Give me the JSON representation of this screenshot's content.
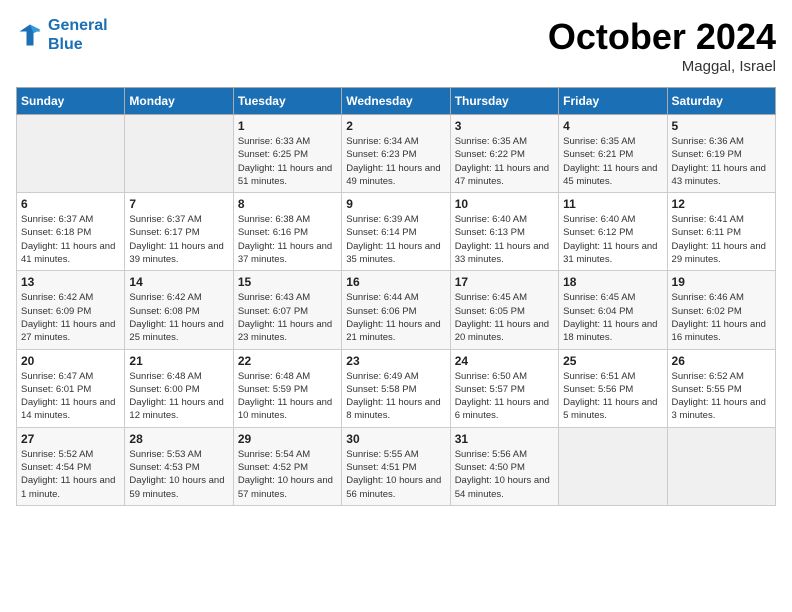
{
  "header": {
    "logo_line1": "General",
    "logo_line2": "Blue",
    "month": "October 2024",
    "location": "Maggal, Israel"
  },
  "weekdays": [
    "Sunday",
    "Monday",
    "Tuesday",
    "Wednesday",
    "Thursday",
    "Friday",
    "Saturday"
  ],
  "weeks": [
    [
      {
        "day": "",
        "sunrise": "",
        "sunset": "",
        "daylight": "",
        "empty": true
      },
      {
        "day": "",
        "sunrise": "",
        "sunset": "",
        "daylight": "",
        "empty": true
      },
      {
        "day": "1",
        "sunrise": "Sunrise: 6:33 AM",
        "sunset": "Sunset: 6:25 PM",
        "daylight": "Daylight: 11 hours and 51 minutes."
      },
      {
        "day": "2",
        "sunrise": "Sunrise: 6:34 AM",
        "sunset": "Sunset: 6:23 PM",
        "daylight": "Daylight: 11 hours and 49 minutes."
      },
      {
        "day": "3",
        "sunrise": "Sunrise: 6:35 AM",
        "sunset": "Sunset: 6:22 PM",
        "daylight": "Daylight: 11 hours and 47 minutes."
      },
      {
        "day": "4",
        "sunrise": "Sunrise: 6:35 AM",
        "sunset": "Sunset: 6:21 PM",
        "daylight": "Daylight: 11 hours and 45 minutes."
      },
      {
        "day": "5",
        "sunrise": "Sunrise: 6:36 AM",
        "sunset": "Sunset: 6:19 PM",
        "daylight": "Daylight: 11 hours and 43 minutes."
      }
    ],
    [
      {
        "day": "6",
        "sunrise": "Sunrise: 6:37 AM",
        "sunset": "Sunset: 6:18 PM",
        "daylight": "Daylight: 11 hours and 41 minutes."
      },
      {
        "day": "7",
        "sunrise": "Sunrise: 6:37 AM",
        "sunset": "Sunset: 6:17 PM",
        "daylight": "Daylight: 11 hours and 39 minutes."
      },
      {
        "day": "8",
        "sunrise": "Sunrise: 6:38 AM",
        "sunset": "Sunset: 6:16 PM",
        "daylight": "Daylight: 11 hours and 37 minutes."
      },
      {
        "day": "9",
        "sunrise": "Sunrise: 6:39 AM",
        "sunset": "Sunset: 6:14 PM",
        "daylight": "Daylight: 11 hours and 35 minutes."
      },
      {
        "day": "10",
        "sunrise": "Sunrise: 6:40 AM",
        "sunset": "Sunset: 6:13 PM",
        "daylight": "Daylight: 11 hours and 33 minutes."
      },
      {
        "day": "11",
        "sunrise": "Sunrise: 6:40 AM",
        "sunset": "Sunset: 6:12 PM",
        "daylight": "Daylight: 11 hours and 31 minutes."
      },
      {
        "day": "12",
        "sunrise": "Sunrise: 6:41 AM",
        "sunset": "Sunset: 6:11 PM",
        "daylight": "Daylight: 11 hours and 29 minutes."
      }
    ],
    [
      {
        "day": "13",
        "sunrise": "Sunrise: 6:42 AM",
        "sunset": "Sunset: 6:09 PM",
        "daylight": "Daylight: 11 hours and 27 minutes."
      },
      {
        "day": "14",
        "sunrise": "Sunrise: 6:42 AM",
        "sunset": "Sunset: 6:08 PM",
        "daylight": "Daylight: 11 hours and 25 minutes."
      },
      {
        "day": "15",
        "sunrise": "Sunrise: 6:43 AM",
        "sunset": "Sunset: 6:07 PM",
        "daylight": "Daylight: 11 hours and 23 minutes."
      },
      {
        "day": "16",
        "sunrise": "Sunrise: 6:44 AM",
        "sunset": "Sunset: 6:06 PM",
        "daylight": "Daylight: 11 hours and 21 minutes."
      },
      {
        "day": "17",
        "sunrise": "Sunrise: 6:45 AM",
        "sunset": "Sunset: 6:05 PM",
        "daylight": "Daylight: 11 hours and 20 minutes."
      },
      {
        "day": "18",
        "sunrise": "Sunrise: 6:45 AM",
        "sunset": "Sunset: 6:04 PM",
        "daylight": "Daylight: 11 hours and 18 minutes."
      },
      {
        "day": "19",
        "sunrise": "Sunrise: 6:46 AM",
        "sunset": "Sunset: 6:02 PM",
        "daylight": "Daylight: 11 hours and 16 minutes."
      }
    ],
    [
      {
        "day": "20",
        "sunrise": "Sunrise: 6:47 AM",
        "sunset": "Sunset: 6:01 PM",
        "daylight": "Daylight: 11 hours and 14 minutes."
      },
      {
        "day": "21",
        "sunrise": "Sunrise: 6:48 AM",
        "sunset": "Sunset: 6:00 PM",
        "daylight": "Daylight: 11 hours and 12 minutes."
      },
      {
        "day": "22",
        "sunrise": "Sunrise: 6:48 AM",
        "sunset": "Sunset: 5:59 PM",
        "daylight": "Daylight: 11 hours and 10 minutes."
      },
      {
        "day": "23",
        "sunrise": "Sunrise: 6:49 AM",
        "sunset": "Sunset: 5:58 PM",
        "daylight": "Daylight: 11 hours and 8 minutes."
      },
      {
        "day": "24",
        "sunrise": "Sunrise: 6:50 AM",
        "sunset": "Sunset: 5:57 PM",
        "daylight": "Daylight: 11 hours and 6 minutes."
      },
      {
        "day": "25",
        "sunrise": "Sunrise: 6:51 AM",
        "sunset": "Sunset: 5:56 PM",
        "daylight": "Daylight: 11 hours and 5 minutes."
      },
      {
        "day": "26",
        "sunrise": "Sunrise: 6:52 AM",
        "sunset": "Sunset: 5:55 PM",
        "daylight": "Daylight: 11 hours and 3 minutes."
      }
    ],
    [
      {
        "day": "27",
        "sunrise": "Sunrise: 5:52 AM",
        "sunset": "Sunset: 4:54 PM",
        "daylight": "Daylight: 11 hours and 1 minute."
      },
      {
        "day": "28",
        "sunrise": "Sunrise: 5:53 AM",
        "sunset": "Sunset: 4:53 PM",
        "daylight": "Daylight: 10 hours and 59 minutes."
      },
      {
        "day": "29",
        "sunrise": "Sunrise: 5:54 AM",
        "sunset": "Sunset: 4:52 PM",
        "daylight": "Daylight: 10 hours and 57 minutes."
      },
      {
        "day": "30",
        "sunrise": "Sunrise: 5:55 AM",
        "sunset": "Sunset: 4:51 PM",
        "daylight": "Daylight: 10 hours and 56 minutes."
      },
      {
        "day": "31",
        "sunrise": "Sunrise: 5:56 AM",
        "sunset": "Sunset: 4:50 PM",
        "daylight": "Daylight: 10 hours and 54 minutes."
      },
      {
        "day": "",
        "sunrise": "",
        "sunset": "",
        "daylight": "",
        "empty": true
      },
      {
        "day": "",
        "sunrise": "",
        "sunset": "",
        "daylight": "",
        "empty": true
      }
    ]
  ]
}
